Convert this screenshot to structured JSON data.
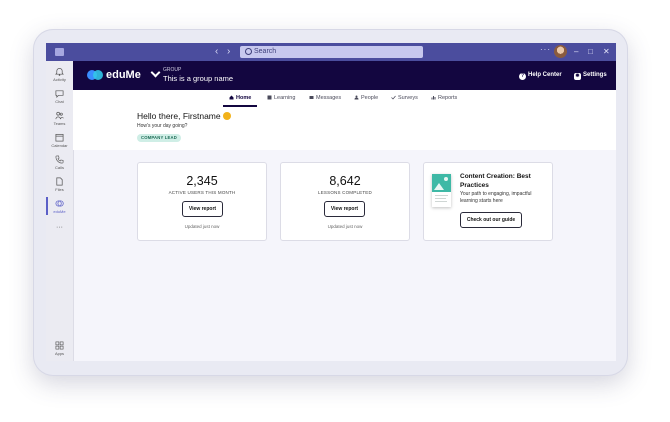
{
  "titlebar": {
    "back": "‹",
    "forward": "›",
    "search_placeholder": "Search",
    "more": "···",
    "minimize": "–",
    "maximize": "□",
    "close": "✕"
  },
  "rail": {
    "items": [
      {
        "label": "Activity",
        "icon": "bell-icon"
      },
      {
        "label": "Chat",
        "icon": "chat-icon"
      },
      {
        "label": "Teams",
        "icon": "teams-icon"
      },
      {
        "label": "Calendar",
        "icon": "calendar-icon"
      },
      {
        "label": "Calls",
        "icon": "phone-icon"
      },
      {
        "label": "Files",
        "icon": "file-icon"
      },
      {
        "label": "eduMe",
        "icon": "edume-icon",
        "active": true
      }
    ],
    "more": "···",
    "apps_label": "Apps"
  },
  "header": {
    "brand": "eduMe",
    "group_label": "GROUP",
    "group_name": "This is a group name",
    "help": "Help Center",
    "settings": "Settings",
    "colors": {
      "background": "#130640",
      "logo_left": "#3a8dff",
      "logo_right": "#33c6e8"
    }
  },
  "tabs": [
    {
      "label": "Home",
      "icon": "home-icon",
      "active": true
    },
    {
      "label": "Learning",
      "icon": "book-icon"
    },
    {
      "label": "Messages",
      "icon": "mail-icon"
    },
    {
      "label": "People",
      "icon": "person-icon"
    },
    {
      "label": "Surveys",
      "icon": "check-icon"
    },
    {
      "label": "Reports",
      "icon": "bar-chart-icon"
    }
  ],
  "greeting": {
    "title": "Hello there, Firstname",
    "subtitle": "How's your day going?",
    "badge": "COMPANY LEAD"
  },
  "cards": {
    "active_users": {
      "value": "2,345",
      "label": "ACTIVE USERS THIS MONTH",
      "button": "View report",
      "updated": "Updated just now"
    },
    "lessons": {
      "value": "8,642",
      "label": "LESSONS COMPLETED",
      "button": "View report",
      "updated": "Updated just now"
    },
    "content": {
      "title": "Content Creation: Best Practices",
      "description": "Your path to engaging, impactful learning starts here",
      "button": "Check out our guide"
    }
  }
}
